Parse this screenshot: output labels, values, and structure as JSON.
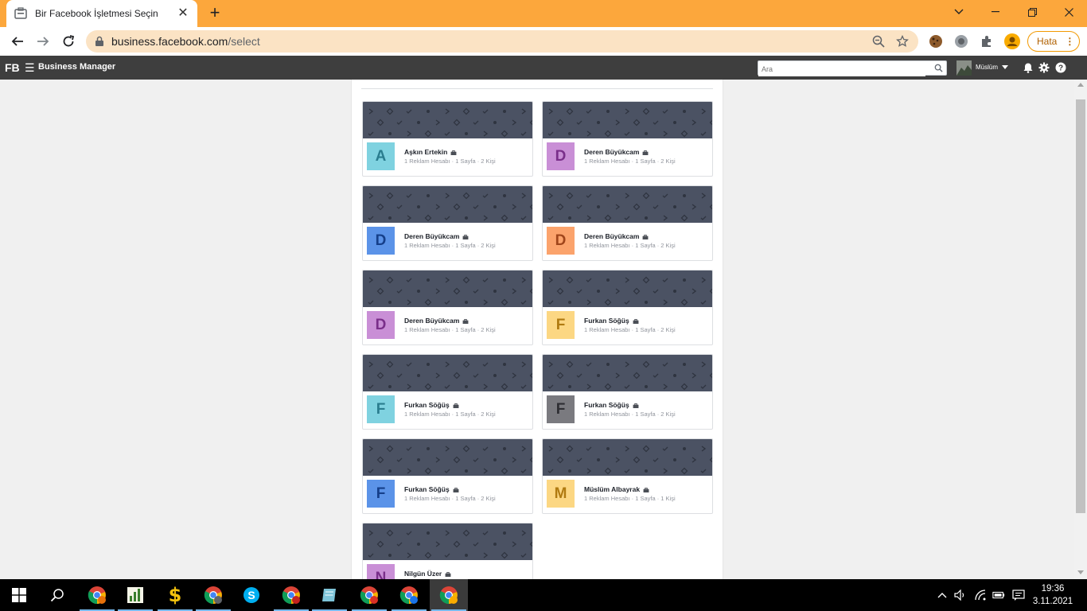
{
  "browser": {
    "tab_title": "Bir Facebook İşletmesi Seçin",
    "url_host": "business.facebook.com",
    "url_path": "/select",
    "profile_label": "Hata"
  },
  "fb_header": {
    "logo": "FB",
    "app_title": "Business Manager",
    "search_placeholder": "Ara",
    "user_name": "Müslüm"
  },
  "businesses": [
    {
      "name": "Aşkın Ertekin",
      "meta": "1 Reklam Hesabı · 1 Sayfa · 2 Kişi",
      "initial": "A",
      "bg": "#7fd2e0",
      "fg": "#2a7d8f"
    },
    {
      "name": "Deren Büyükcam",
      "meta": "1 Reklam Hesabı · 1 Sayfa · 2 Kişi",
      "initial": "D",
      "bg": "#c98fd6",
      "fg": "#7a2f8a"
    },
    {
      "name": "Deren Büyükcam",
      "meta": "1 Reklam Hesabı · 1 Sayfa · 2 Kişi",
      "initial": "D",
      "bg": "#5b93e8",
      "fg": "#153f8a"
    },
    {
      "name": "Deren Büyükcam",
      "meta": "1 Reklam Hesabı · 1 Sayfa · 2 Kişi",
      "initial": "D",
      "bg": "#fba36c",
      "fg": "#a0451a"
    },
    {
      "name": "Deren Büyükcam",
      "meta": "1 Reklam Hesabı · 1 Sayfa · 2 Kişi",
      "initial": "D",
      "bg": "#c98fd6",
      "fg": "#7a2f8a"
    },
    {
      "name": "Furkan Söğüş",
      "meta": "1 Reklam Hesabı · 1 Sayfa · 2 Kişi",
      "initial": "F",
      "bg": "#fcd783",
      "fg": "#b07a10"
    },
    {
      "name": "Furkan Söğüş",
      "meta": "1 Reklam Hesabı · 1 Sayfa · 2 Kişi",
      "initial": "F",
      "bg": "#7fd2e0",
      "fg": "#2a7d8f"
    },
    {
      "name": "Furkan Söğüş",
      "meta": "1 Reklam Hesabı · 1 Sayfa · 2 Kişi",
      "initial": "F",
      "bg": "#7a7a7f",
      "fg": "#2e2e33"
    },
    {
      "name": "Furkan Söğüş",
      "meta": "1 Reklam Hesabı · 1 Sayfa · 2 Kişi",
      "initial": "F",
      "bg": "#5b93e8",
      "fg": "#153f8a"
    },
    {
      "name": "Müslüm Albayrak",
      "meta": "1 Reklam Hesabı · 1 Sayfa · 1 Kişi",
      "initial": "M",
      "bg": "#fcd783",
      "fg": "#b07a10"
    },
    {
      "name": "Nilgün Üzer",
      "meta": "",
      "initial": "N",
      "bg": "#c98fd6",
      "fg": "#7a2f8a"
    }
  ],
  "taskbar": {
    "time": "19:36",
    "date": "3.11.2021"
  }
}
